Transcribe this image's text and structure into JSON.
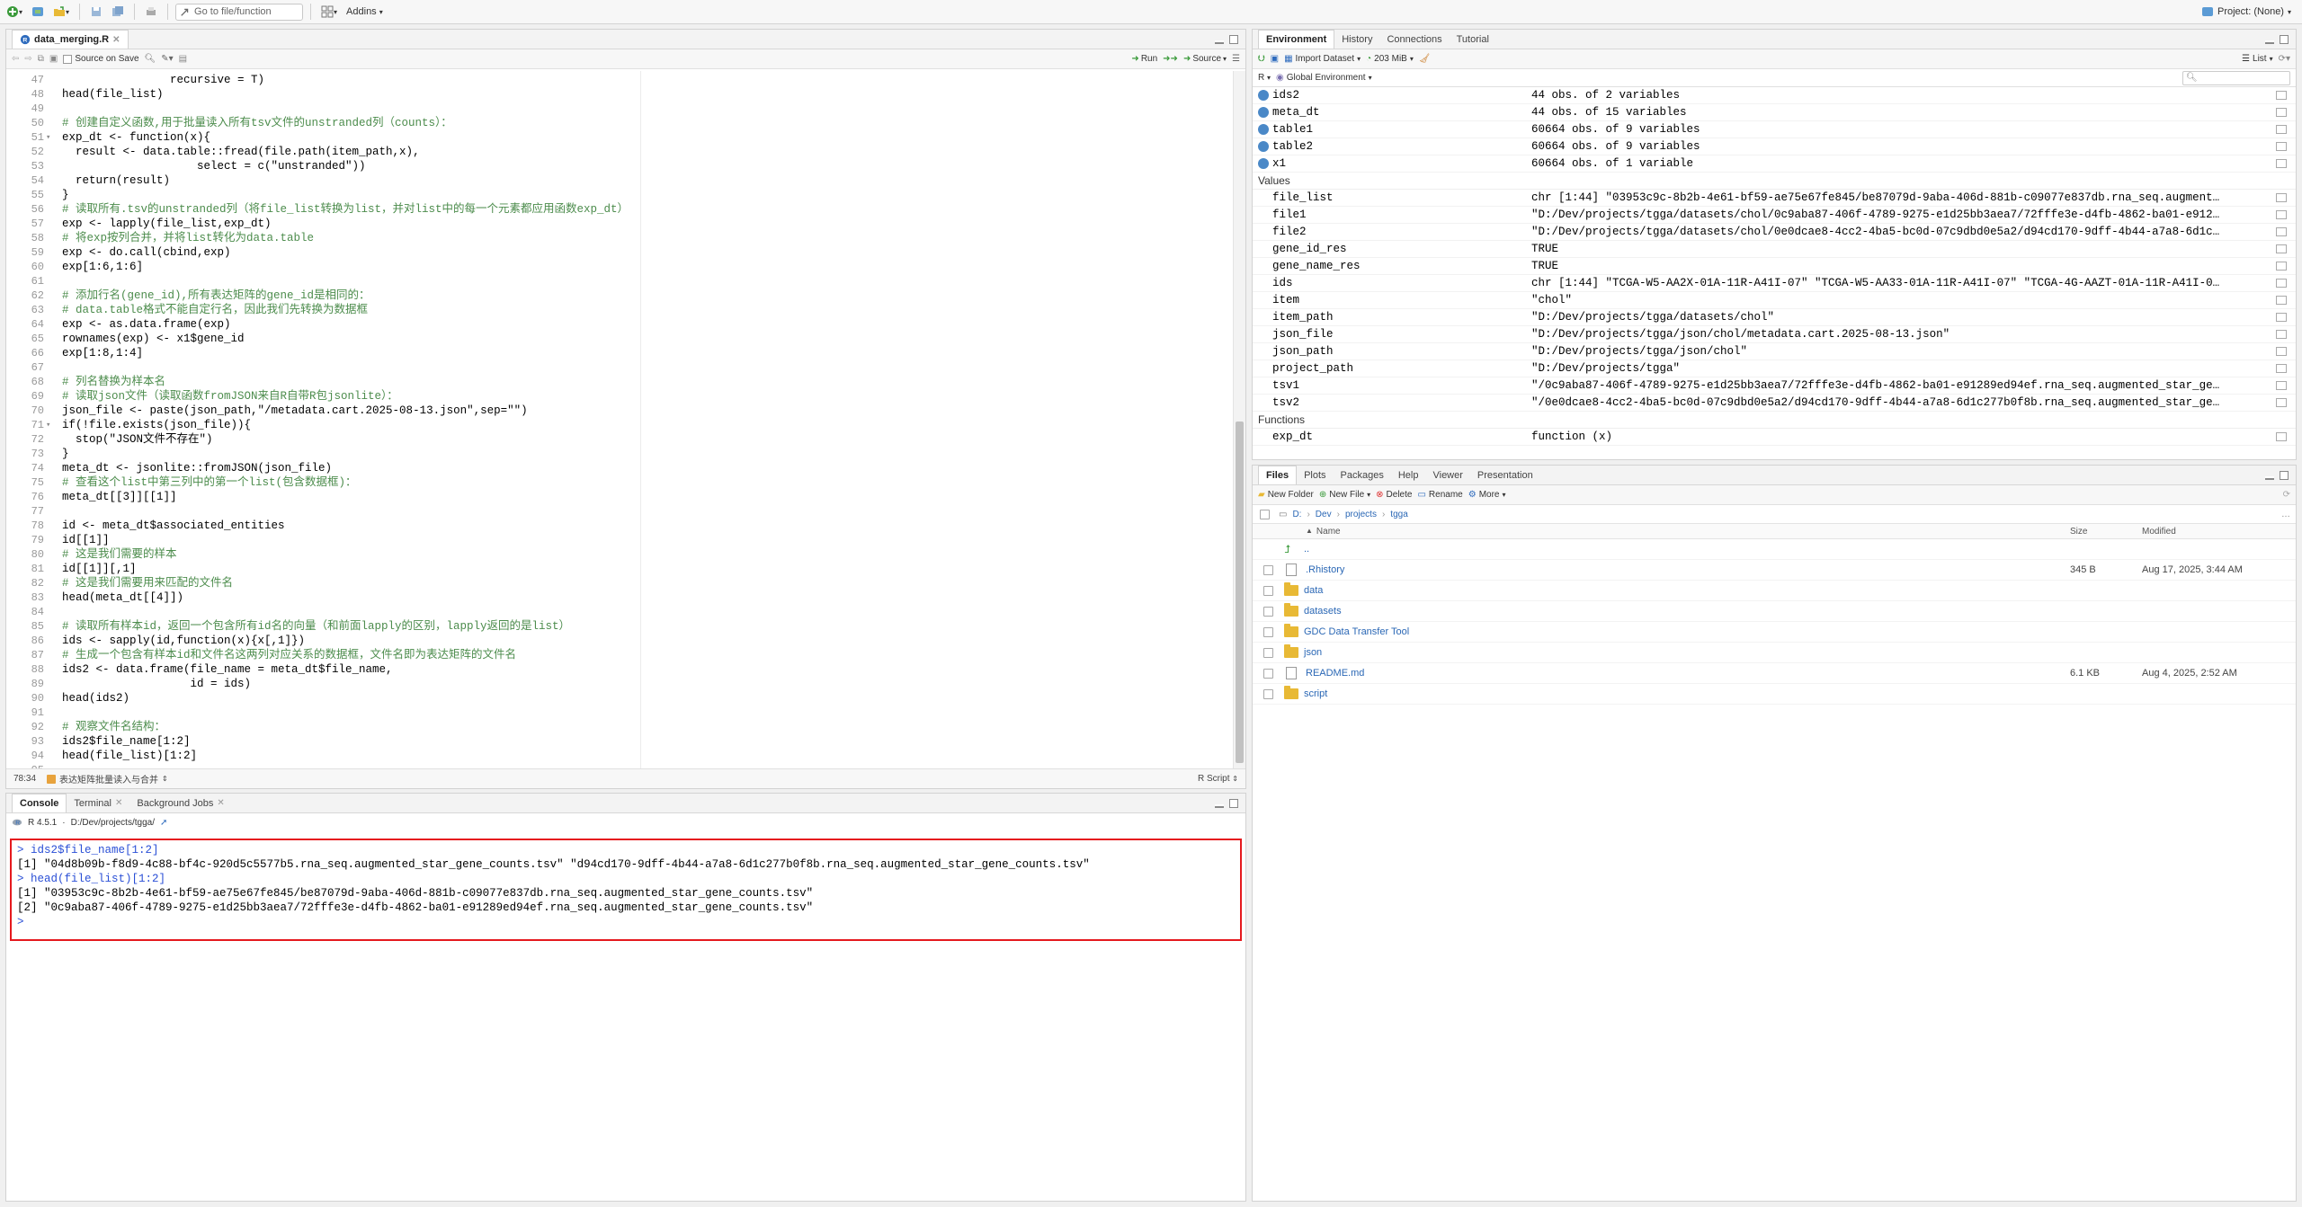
{
  "topbar": {
    "goto_placeholder": "Go to file/function",
    "addins_label": "Addins",
    "project_label": "Project: (None)"
  },
  "editor": {
    "tab_label": "data_merging.R",
    "source_on_save_label": "Source on Save",
    "run_label": "Run",
    "source_label": "Source",
    "cursor_pos": "78:34",
    "function_indicator": "表达矩阵批量读入与合并",
    "file_type": "R Script",
    "lines": [
      {
        "n": "47",
        "t": "                recursive = T)"
      },
      {
        "n": "48",
        "t": "head(file_list)"
      },
      {
        "n": "49",
        "t": ""
      },
      {
        "n": "50",
        "t": "# 创建自定义函数,用于批量读入所有tsv文件的unstranded列（counts）："
      },
      {
        "n": "51",
        "t": "exp_dt <- function(x){",
        "f": "▾"
      },
      {
        "n": "52",
        "t": "  result <- data.table::fread(file.path(item_path,x),"
      },
      {
        "n": "53",
        "t": "                    select = c(\"unstranded\"))"
      },
      {
        "n": "54",
        "t": "  return(result)"
      },
      {
        "n": "55",
        "t": "}"
      },
      {
        "n": "56",
        "t": "# 读取所有.tsv的unstranded列（将file_list转换为list，并对list中的每一个元素都应用函数exp_dt）"
      },
      {
        "n": "57",
        "t": "exp <- lapply(file_list,exp_dt)"
      },
      {
        "n": "58",
        "t": "# 将exp按列合并，并将list转化为data.table"
      },
      {
        "n": "59",
        "t": "exp <- do.call(cbind,exp)"
      },
      {
        "n": "60",
        "t": "exp[1:6,1:6]"
      },
      {
        "n": "61",
        "t": ""
      },
      {
        "n": "62",
        "t": "# 添加行名(gene_id),所有表达矩阵的gene_id是相同的："
      },
      {
        "n": "63",
        "t": "# data.table格式不能自定行名，因此我们先转换为数据框"
      },
      {
        "n": "64",
        "t": "exp <- as.data.frame(exp)"
      },
      {
        "n": "65",
        "t": "rownames(exp) <- x1$gene_id"
      },
      {
        "n": "66",
        "t": "exp[1:8,1:4]"
      },
      {
        "n": "67",
        "t": ""
      },
      {
        "n": "68",
        "t": "# 列名替换为样本名"
      },
      {
        "n": "69",
        "t": "# 读取json文件（读取函数fromJSON来自R自带R包jsonlite）："
      },
      {
        "n": "70",
        "t": "json_file <- paste(json_path,\"/metadata.cart.2025-08-13.json\",sep=\"\")"
      },
      {
        "n": "71",
        "t": "if(!file.exists(json_file)){",
        "f": "▾"
      },
      {
        "n": "72",
        "t": "  stop(\"JSON文件不存在\")"
      },
      {
        "n": "73",
        "t": "}"
      },
      {
        "n": "74",
        "t": "meta_dt <- jsonlite::fromJSON(json_file)"
      },
      {
        "n": "75",
        "t": "# 查看这个list中第三列中的第一个list(包含数据框)："
      },
      {
        "n": "76",
        "t": "meta_dt[[3]][[1]]"
      },
      {
        "n": "77",
        "t": ""
      },
      {
        "n": "78",
        "t": "id <- meta_dt$associated_entities"
      },
      {
        "n": "79",
        "t": "id[[1]]"
      },
      {
        "n": "80",
        "t": "# 这是我们需要的样本"
      },
      {
        "n": "81",
        "t": "id[[1]][,1]"
      },
      {
        "n": "82",
        "t": "# 这是我们需要用来匹配的文件名"
      },
      {
        "n": "83",
        "t": "head(meta_dt[[4]])"
      },
      {
        "n": "84",
        "t": ""
      },
      {
        "n": "85",
        "t": "# 读取所有样本id，返回一个包含所有id名的向量（和前面lapply的区别，lapply返回的是list）"
      },
      {
        "n": "86",
        "t": "ids <- sapply(id,function(x){x[,1]})"
      },
      {
        "n": "87",
        "t": "# 生成一个包含有样本id和文件名这两列对应关系的数据框，文件名即为表达矩阵的文件名"
      },
      {
        "n": "88",
        "t": "ids2 <- data.frame(file_name = meta_dt$file_name,"
      },
      {
        "n": "89",
        "t": "                   id = ids)"
      },
      {
        "n": "90",
        "t": "head(ids2)"
      },
      {
        "n": "91",
        "t": ""
      },
      {
        "n": "92",
        "t": "# 观察文件名结构："
      },
      {
        "n": "93",
        "t": "ids2$file_name[1:2]"
      },
      {
        "n": "94",
        "t": "head(file_list)[1:2]"
      },
      {
        "n": "95",
        "t": ""
      }
    ]
  },
  "console": {
    "tabs": [
      "Console",
      "Terminal",
      "Background Jobs"
    ],
    "r_version": "R 4.5.1",
    "path": "D:/Dev/projects/tgga/",
    "lines": [
      "> ids2$file_name[1:2]",
      "[1] \"04d8b09b-f8d9-4c88-bf4c-920d5c5577b5.rna_seq.augmented_star_gene_counts.tsv\" \"d94cd170-9dff-4b44-a7a8-6d1c277b0f8b.rna_seq.augmented_star_gene_counts.tsv\"",
      "> head(file_list)[1:2]",
      "[1] \"03953c9c-8b2b-4e61-bf59-ae75e67fe845/be87079d-9aba-406d-881b-c09077e837db.rna_seq.augmented_star_gene_counts.tsv\"",
      "[2] \"0c9aba87-406f-4789-9275-e1d25bb3aea7/72fffe3e-d4fb-4862-ba01-e91289ed94ef.rna_seq.augmented_star_gene_counts.tsv\"",
      "> "
    ]
  },
  "environment": {
    "tabs": [
      "Environment",
      "History",
      "Connections",
      "Tutorial"
    ],
    "import_label": "Import Dataset",
    "memory_label": "203 MiB",
    "list_label": "List",
    "r_label": "R",
    "scope_label": "Global Environment",
    "data_rows": [
      {
        "name": "ids2",
        "value": "44 obs. of 2 variables"
      },
      {
        "name": "meta_dt",
        "value": "44 obs. of 15 variables"
      },
      {
        "name": "table1",
        "value": "60664 obs. of 9 variables"
      },
      {
        "name": "table2",
        "value": "60664 obs. of 9 variables"
      },
      {
        "name": "x1",
        "value": "60664 obs. of 1 variable"
      }
    ],
    "values_header": "Values",
    "value_rows": [
      {
        "name": "file_list",
        "value": "chr [1:44] \"03953c9c-8b2b-4e61-bf59-ae75e67fe845/be87079d-9aba-406d-881b-c09077e837db.rna_seq.augment…"
      },
      {
        "name": "file1",
        "value": "\"D:/Dev/projects/tgga/datasets/chol/0c9aba87-406f-4789-9275-e1d25bb3aea7/72fffe3e-d4fb-4862-ba01-e912…"
      },
      {
        "name": "file2",
        "value": "\"D:/Dev/projects/tgga/datasets/chol/0e0dcae8-4cc2-4ba5-bc0d-07c9dbd0e5a2/d94cd170-9dff-4b44-a7a8-6d1c…"
      },
      {
        "name": "gene_id_res",
        "value": "TRUE"
      },
      {
        "name": "gene_name_res",
        "value": "TRUE"
      },
      {
        "name": "ids",
        "value": "chr [1:44] \"TCGA-W5-AA2X-01A-11R-A41I-07\" \"TCGA-W5-AA33-01A-11R-A41I-07\" \"TCGA-4G-AAZT-01A-11R-A41I-0…"
      },
      {
        "name": "item",
        "value": "\"chol\""
      },
      {
        "name": "item_path",
        "value": "\"D:/Dev/projects/tgga/datasets/chol\""
      },
      {
        "name": "json_file",
        "value": "\"D:/Dev/projects/tgga/json/chol/metadata.cart.2025-08-13.json\""
      },
      {
        "name": "json_path",
        "value": "\"D:/Dev/projects/tgga/json/chol\""
      },
      {
        "name": "project_path",
        "value": "\"D:/Dev/projects/tgga\""
      },
      {
        "name": "tsv1",
        "value": "\"/0c9aba87-406f-4789-9275-e1d25bb3aea7/72fffe3e-d4fb-4862-ba01-e91289ed94ef.rna_seq.augmented_star_ge…"
      },
      {
        "name": "tsv2",
        "value": "\"/0e0dcae8-4cc2-4ba5-bc0d-07c9dbd0e5a2/d94cd170-9dff-4b44-a7a8-6d1c277b0f8b.rna_seq.augmented_star_ge…"
      }
    ],
    "functions_header": "Functions",
    "function_rows": [
      {
        "name": "exp_dt",
        "value": "function (x)"
      }
    ]
  },
  "files": {
    "tabs": [
      "Files",
      "Plots",
      "Packages",
      "Help",
      "Viewer",
      "Presentation"
    ],
    "new_folder": "New Folder",
    "new_file": "New File",
    "delete": "Delete",
    "rename": "Rename",
    "more": "More",
    "breadcrumb": [
      "D:",
      "Dev",
      "projects",
      "tgga"
    ],
    "col_name": "Name",
    "col_size": "Size",
    "col_modified": "Modified",
    "up_label": "..",
    "rows": [
      {
        "name": ".Rhistory",
        "size": "345 B",
        "modified": "Aug 17, 2025, 3:44 AM",
        "type": "file"
      },
      {
        "name": "data",
        "size": "",
        "modified": "",
        "type": "folder"
      },
      {
        "name": "datasets",
        "size": "",
        "modified": "",
        "type": "folder"
      },
      {
        "name": "GDC Data Transfer Tool",
        "size": "",
        "modified": "",
        "type": "folder"
      },
      {
        "name": "json",
        "size": "",
        "modified": "",
        "type": "folder"
      },
      {
        "name": "README.md",
        "size": "6.1 KB",
        "modified": "Aug 4, 2025, 2:52 AM",
        "type": "md"
      },
      {
        "name": "script",
        "size": "",
        "modified": "",
        "type": "folder"
      }
    ]
  }
}
